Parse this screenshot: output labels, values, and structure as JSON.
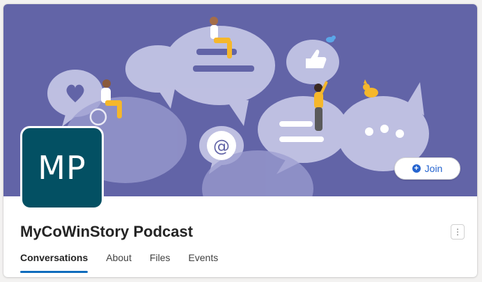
{
  "group": {
    "avatar_initials": "MP",
    "name": "MyCoWinStory Podcast"
  },
  "actions": {
    "join_label": "Join",
    "join_icon": "plus-circle-icon",
    "more_icon": "more-vertical-icon"
  },
  "tabs": [
    {
      "label": "Conversations",
      "active": true
    },
    {
      "label": "About",
      "active": false
    },
    {
      "label": "Files",
      "active": false
    },
    {
      "label": "Events",
      "active": false
    }
  ],
  "colors": {
    "banner": "#6264a7",
    "avatar": "#035063",
    "accent": "#0f6cbd",
    "join_text": "#2564cf"
  }
}
